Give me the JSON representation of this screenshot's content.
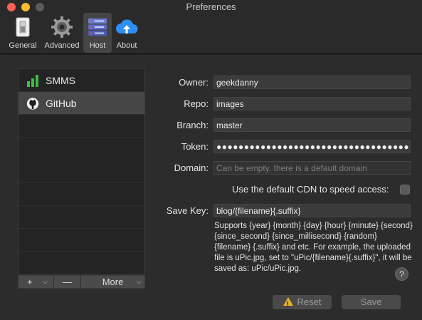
{
  "window": {
    "title": "Preferences"
  },
  "toolbar": {
    "items": [
      {
        "label": "General",
        "icon": "switch-icon"
      },
      {
        "label": "Advanced",
        "icon": "gear-icon"
      },
      {
        "label": "Host",
        "icon": "server-icon",
        "selected": true
      },
      {
        "label": "About",
        "icon": "cloud-upload-icon"
      }
    ]
  },
  "hosts": {
    "items": [
      {
        "name": "SMMS",
        "icon": "bars-icon",
        "icon_color": "#3dbd45"
      },
      {
        "name": "GitHub",
        "icon": "github-icon",
        "selected": true
      }
    ],
    "add_label": "+",
    "remove_label": "—",
    "more_label": "More"
  },
  "form": {
    "owner": {
      "label": "Owner:",
      "value": "geekdanny"
    },
    "repo": {
      "label": "Repo:",
      "value": "images"
    },
    "branch": {
      "label": "Branch:",
      "value": "master"
    },
    "token": {
      "label": "Token:",
      "value": "●●●●●●●●●●●●●●●●●●●●●●●●●●●●●●●●●●●●●●…"
    },
    "domain": {
      "label": "Domain:",
      "placeholder": "Can be empty, there is a default domain"
    },
    "cdn": {
      "label": "Use the default CDN to speed access:",
      "checked": false
    },
    "save_key": {
      "label": "Save Key:",
      "value": "blog/{filename}{.suffix}"
    },
    "help": "Supports {year} {month} {day} {hour} {minute} {second} {since_second} {since_millisecond} {random} {filename} {.suffix} and etc. For example, the uploaded file is uPic.jpg, set to \"uPic/{filename}{.suffix}\", it will be saved as: uPic/uPic.jpg.",
    "help_button": "?"
  },
  "buttons": {
    "reset": "Reset",
    "save": "Save"
  }
}
